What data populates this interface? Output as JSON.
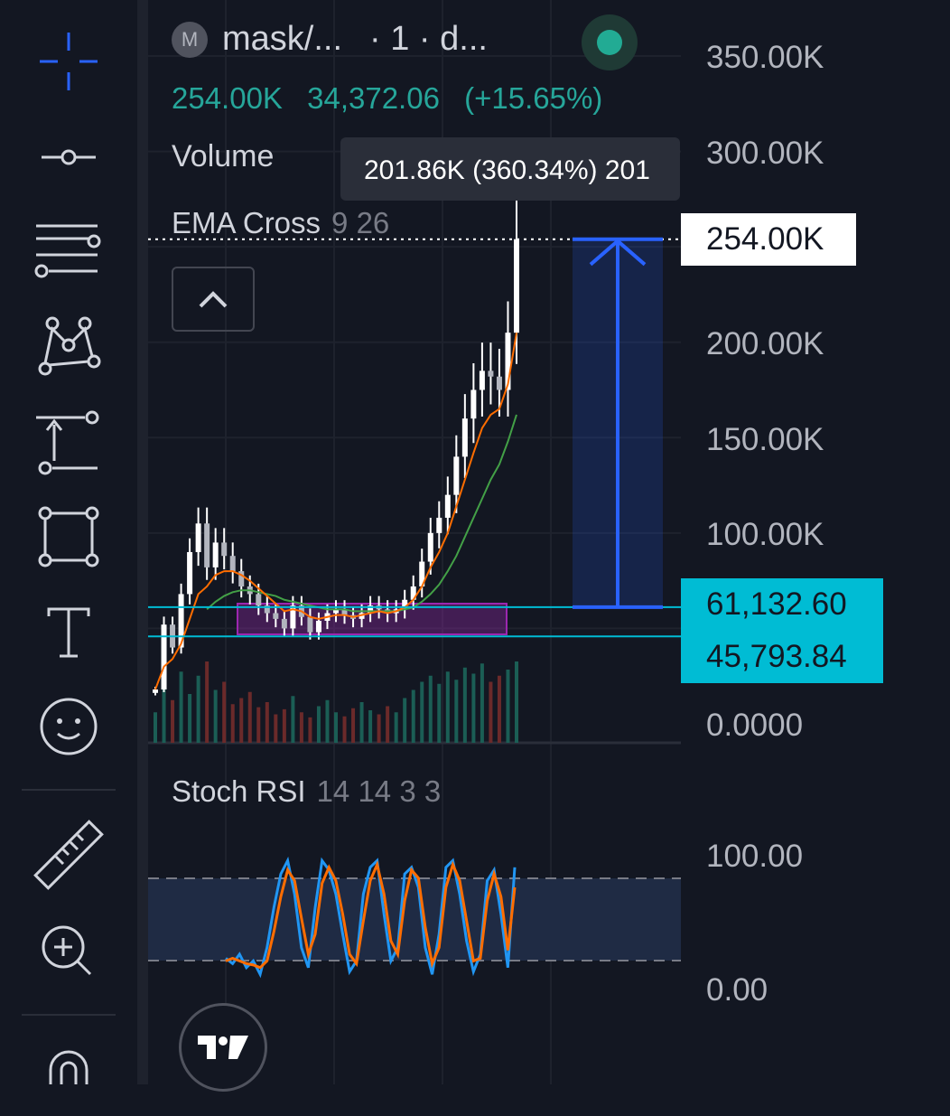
{
  "header": {
    "coin_badge": "M",
    "symbol": "mask/...",
    "interval": "· 1 · d...",
    "last_price": "254.00K",
    "change": "34,372.06",
    "change_pct": "(+15.65%)"
  },
  "indicators": {
    "volume_label": "Volume",
    "volume_tooltip": "201.86K (360.34%) 201",
    "ema_label": "EMA Cross",
    "ema_params": "9 26",
    "stoch_label": "Stoch RSI",
    "stoch_params": "14 14 3 3"
  },
  "toolbar": {
    "tools": [
      "crosshair-icon",
      "trend-line-icon",
      "fib-retracement-icon",
      "pattern-icon",
      "forecast-icon",
      "rectangle-icon",
      "text-icon",
      "emoji-icon",
      "ruler-icon",
      "zoom-in-icon",
      "magnet-icon"
    ]
  },
  "colors": {
    "background": "#131722",
    "up": "#26a69a",
    "candle": "#ffffff",
    "ema_fast": "#ff6d00",
    "ema_slow": "#43a047",
    "measure": "#2962ff",
    "hline": "#00bcd4",
    "zone": "#9c27b0",
    "stoch_k": "#2196f3",
    "stoch_d": "#ff6d00"
  },
  "chart_data": [
    {
      "type": "candlestick",
      "title": "mask/... · 1 · d...",
      "y_ticks": [
        "350.00K",
        "300.00K",
        "200.00K",
        "150.00K",
        "100.00K",
        "0.0000"
      ],
      "ylim": [
        0,
        350000
      ],
      "grid": true,
      "close_series": [
        18000,
        52000,
        40000,
        68000,
        90000,
        105000,
        82000,
        95000,
        88000,
        80000,
        72000,
        68000,
        62000,
        58000,
        55000,
        50000,
        62000,
        56000,
        48000,
        54000,
        58000,
        60000,
        57000,
        55000,
        58000,
        62000,
        60000,
        58000,
        60000,
        65000,
        72000,
        85000,
        100000,
        108000,
        120000,
        140000,
        160000,
        175000,
        185000,
        182000,
        175000,
        205000,
        254000
      ],
      "ema_fast": [
        18000,
        30000,
        34000,
        42000,
        55000,
        68000,
        72000,
        78000,
        80000,
        80000,
        78000,
        75000,
        71000,
        67000,
        63000,
        59000,
        60000,
        59000,
        56000,
        55000,
        56000,
        57000,
        57000,
        56000,
        57000,
        58000,
        59000,
        58000,
        59000,
        61000,
        65000,
        72000,
        82000,
        90000,
        100000,
        114000,
        128000,
        142000,
        155000,
        162000,
        165000,
        178000,
        205000
      ],
      "ema_slow": [
        null,
        null,
        null,
        null,
        null,
        null,
        60000,
        64000,
        67000,
        69000,
        70000,
        70000,
        69000,
        68000,
        67000,
        65000,
        64000,
        63000,
        62000,
        61000,
        60000,
        60000,
        60000,
        59000,
        59000,
        59000,
        59000,
        59000,
        59000,
        60000,
        61000,
        64000,
        68000,
        73000,
        80000,
        88000,
        98000,
        108000,
        118000,
        128000,
        136000,
        148000,
        162000
      ],
      "price_line": {
        "value": 254000,
        "label": "254.00K"
      },
      "horizontal_lines": [
        {
          "value": 61132.6,
          "label": "61,132.60"
        },
        {
          "value": 45793.84,
          "label": "45,793.84"
        }
      ],
      "measure": {
        "from": 61132.6,
        "to": 254000
      }
    },
    {
      "type": "bar",
      "title": "Volume",
      "values": [
        30,
        55,
        42,
        70,
        48,
        66,
        80,
        52,
        60,
        38,
        44,
        50,
        35,
        40,
        28,
        33,
        46,
        30,
        25,
        36,
        42,
        30,
        26,
        34,
        40,
        32,
        28,
        36,
        30,
        44,
        52,
        60,
        66,
        58,
        70,
        62,
        74,
        68,
        78,
        60,
        66,
        72,
        80
      ]
    },
    {
      "type": "line",
      "title": "Stoch RSI",
      "y_ticks": [
        "100.00",
        "0.00"
      ],
      "ylim": [
        0,
        100
      ],
      "bands": [
        80,
        20
      ],
      "k": [
        22,
        18,
        25,
        15,
        20,
        10,
        30,
        60,
        85,
        95,
        70,
        30,
        15,
        60,
        95,
        88,
        70,
        40,
        12,
        20,
        70,
        90,
        95,
        55,
        20,
        30,
        85,
        90,
        75,
        30,
        10,
        40,
        90,
        95,
        70,
        35,
        12,
        25,
        80,
        88,
        55,
        15,
        90
      ],
      "d": [
        20,
        22,
        20,
        18,
        17,
        15,
        20,
        42,
        68,
        88,
        80,
        52,
        25,
        40,
        78,
        90,
        80,
        55,
        25,
        18,
        50,
        80,
        92,
        70,
        35,
        25,
        65,
        88,
        82,
        45,
        18,
        30,
        75,
        92,
        80,
        50,
        20,
        22,
        65,
        85,
        68,
        28,
        75
      ]
    }
  ]
}
